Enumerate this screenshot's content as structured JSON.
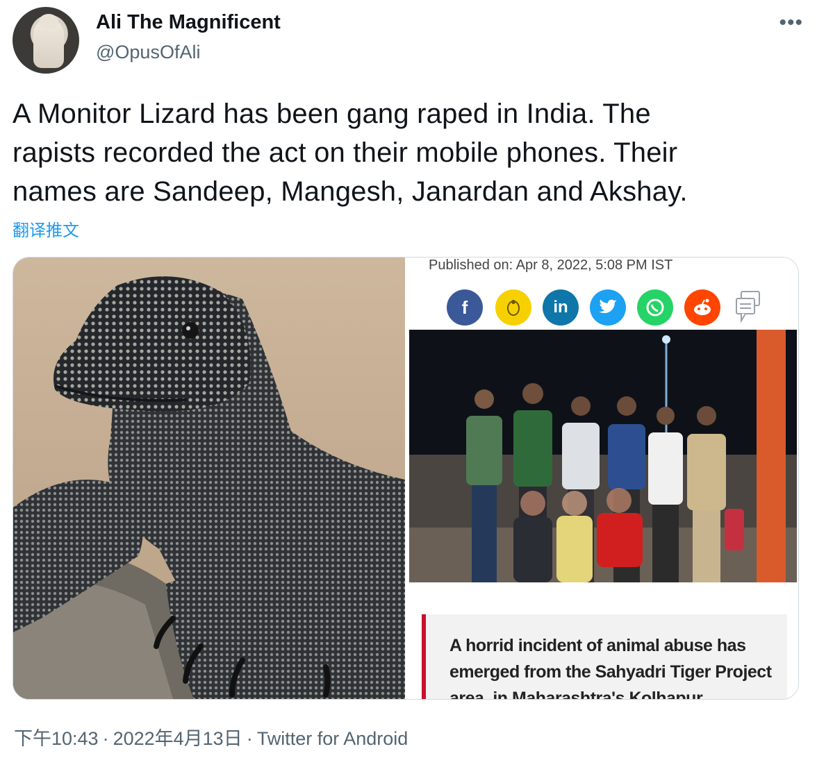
{
  "author": {
    "display_name": "Ali The Magnificent",
    "handle": "@OpusOfAli"
  },
  "tweet": {
    "text": "A Monitor Lizard has been gang raped in India. The\nrapists recorded the act on their mobile phones. Their\nnames are Sandeep, Mangesh, Janardan and Akshay.",
    "translate_label": "翻译推文"
  },
  "more_icon": "more-horizontal-icon",
  "article": {
    "published": "Published on: Apr 8, 2022, 5:08 PM IST",
    "share_icons": [
      "facebook-icon",
      "koo-icon",
      "linkedin-icon",
      "twitter-icon",
      "whatsapp-icon",
      "reddit-icon",
      "comments-icon"
    ],
    "share_colors": [
      "#3b5998",
      "#f7d000",
      "#0e76a8",
      "#1da1f2",
      "#25d366",
      "#ff4500",
      "#9aa0a6"
    ],
    "share_labels": {
      "facebook": "f",
      "linkedin": "in"
    },
    "quote": "A horrid incident of animal abuse has emerged from the Sahyadri Tiger Project area, in Maharashtra's Kolhapur"
  },
  "footer": {
    "time": "下午10:43",
    "date": "2022年4月13日",
    "source": "Twitter for Android",
    "separator": "·"
  }
}
